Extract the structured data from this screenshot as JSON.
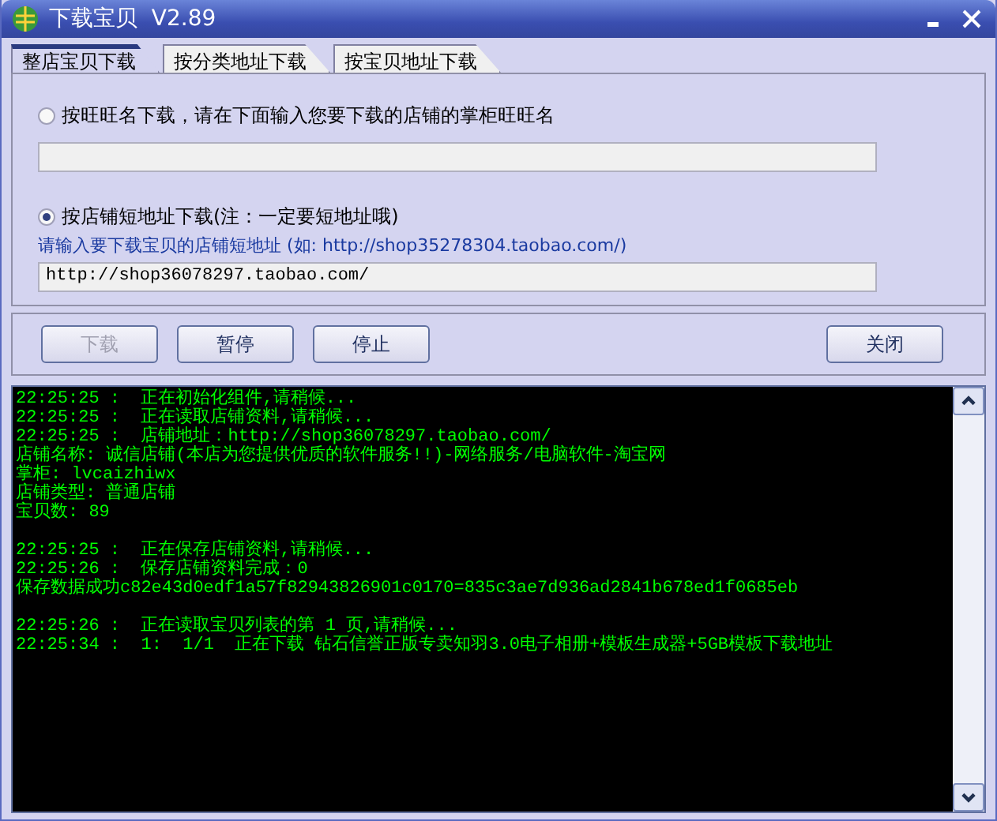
{
  "window": {
    "title": "下载宝贝  V2.89"
  },
  "tabs": [
    {
      "label": "整店宝贝下载",
      "selected": true
    },
    {
      "label": "按分类地址下载",
      "selected": false
    },
    {
      "label": "按宝贝地址下载",
      "selected": false
    }
  ],
  "options": [
    {
      "label": "按旺旺名下载，请在下面输入您要下载的店铺的掌柜旺旺名",
      "selected": false
    },
    {
      "label": "按店铺短地址下载(注：一定要短地址哦)",
      "selected": true,
      "hint": "请输入要下载宝贝的店铺短地址 (如: http://shop35278304.taobao.com/)",
      "value": "http://shop36078297.taobao.com/"
    }
  ],
  "buttons": [
    {
      "label": "下载",
      "disabled": true
    },
    {
      "label": "暂停",
      "disabled": false
    },
    {
      "label": "停止",
      "disabled": false
    },
    {
      "label": "关闭",
      "disabled": false
    }
  ],
  "log": [
    [
      "22:25:25 :  正在初始化组件,请稍候...",
      "22:25:25 :  正在读取店铺资料,请稍候...",
      "22:25:25 :  店铺地址：http://shop36078297.taobao.com/",
      "店铺名称: 诚信店铺(本店为您提供优质的软件服务!!)-网络服务/电脑软件-淘宝网",
      "掌柜: lvcaizhiwx",
      "店铺类型: 普通店铺",
      "宝贝数: 89"
    ],
    [
      "22:25:25 :  正在保存店铺资料,请稍候...",
      "22:25:26 :  保存店铺资料完成：0",
      "保存数据成功c82e43d0edf1a57f82943826901c0170=835c3ae7d936ad2841b678ed1f0685eb"
    ],
    [
      "22:25:26 :  正在读取宝贝列表的第 1 页,请稍候...",
      "22:25:34 :  1:  1/1  正在下载 钻石信誉正版专卖知羽3.0电子相册+模板生成器+5GB模板下载地址"
    ]
  ]
}
